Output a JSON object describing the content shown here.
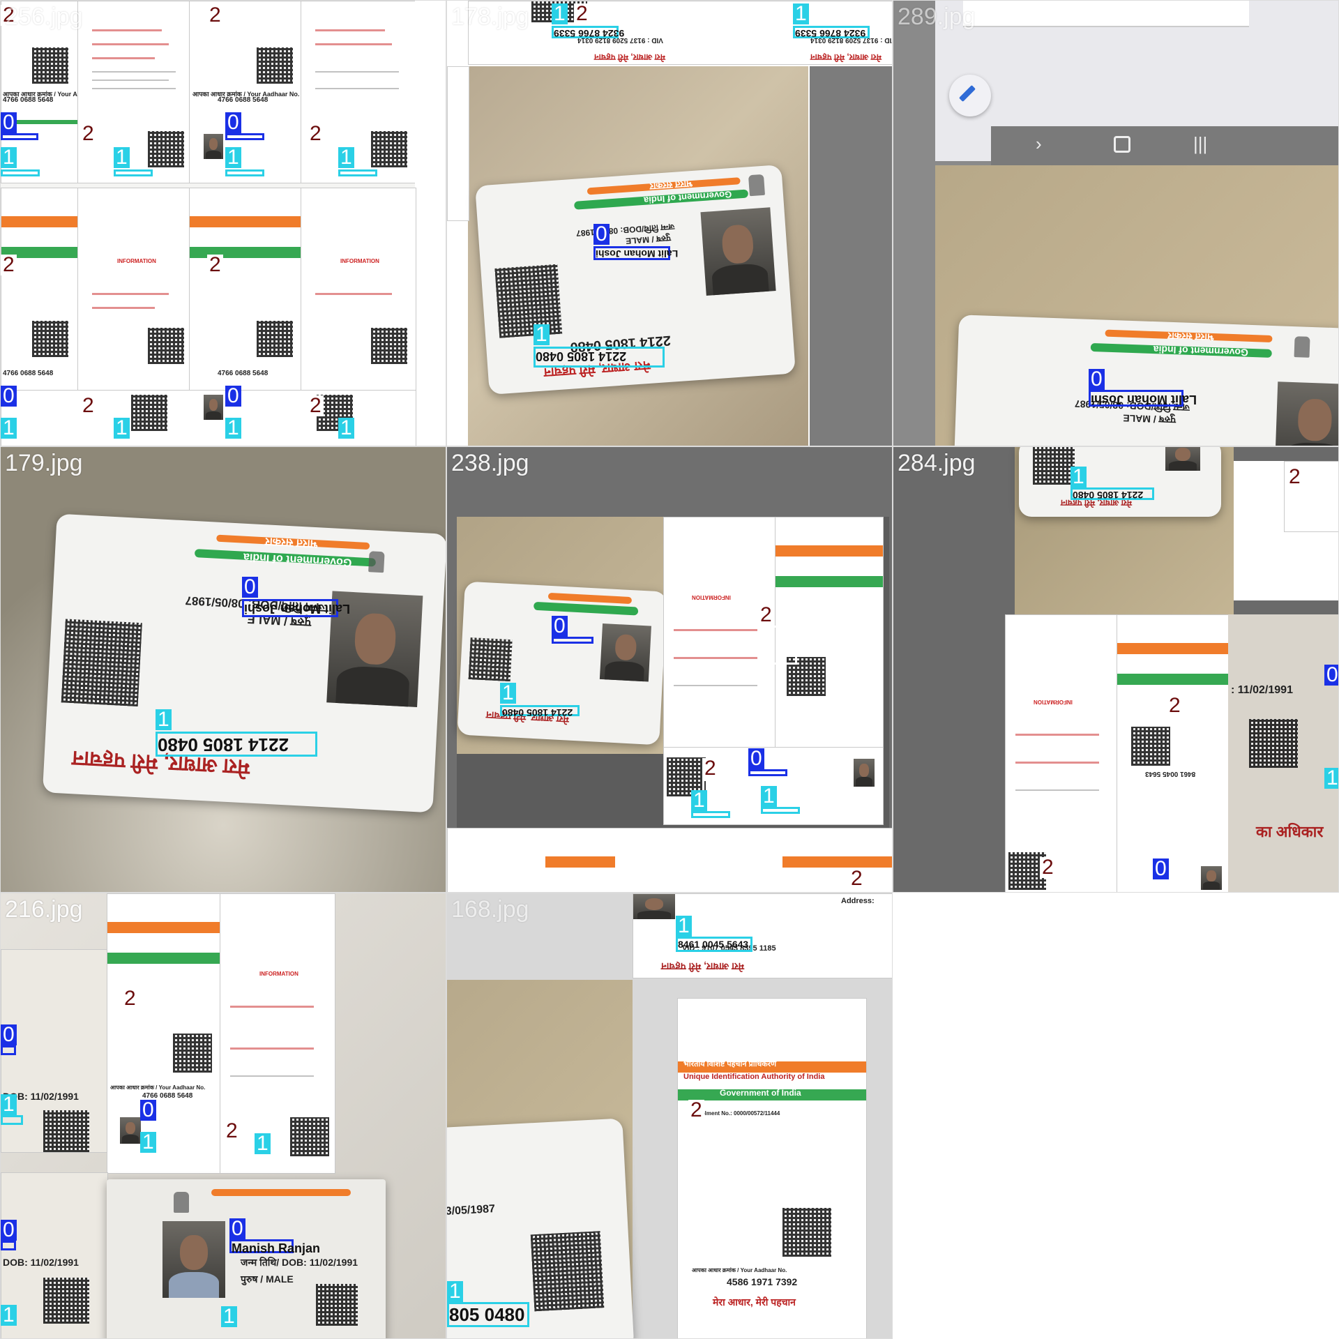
{
  "tiles": [
    {
      "file": "256.jpg"
    },
    {
      "file": "178.jpg"
    },
    {
      "file": "289.jpg"
    },
    {
      "file": "179.jpg"
    },
    {
      "file": "238.jpg"
    },
    {
      "file": "284.jpg"
    },
    {
      "file": "216.jpg"
    },
    {
      "file": "168.jpg"
    }
  ],
  "class_labels": [
    "0",
    "1",
    "2"
  ],
  "class_colors": {
    "0": "#1a30e6",
    "1": "#2ad0e6",
    "2": "#ffffff"
  },
  "card_text": {
    "gov_hi": "भारत सरकार",
    "gov_en": "Government of India",
    "name_lalit": "Lalit Mohan Joshi",
    "dob_lalit": "जन्म तिथि/DOB: 08/05/1987",
    "male": "पुरुष / MALE",
    "num_lalit": "2214 1805 0480",
    "tagline": "मेरा आधार, मेरी पहचान",
    "num_9324": "9324 8766 5339",
    "vid_9324": "VID : 9137 5209 8129 0314",
    "num_4766": "4766 0688 5648",
    "your_aadhaar_no": "आपका आधार क्रमांक / Your Aadhaar No.",
    "num_8461": "8461 0045 5643",
    "vid_8461": "VID : 9107 0543 8395 1185",
    "num_4586": "4586 1971 7392",
    "name_manish": "Manish Ranjan",
    "dob_manish": "जन्म तिथि/ DOB: 11/02/1991",
    "dob_short": "DOB: 11/02/1991",
    "uidai_hi": "भारतीय विशिष्ट पहचान प्राधिकरण",
    "uidai_en": "Unique Identification Authority of India",
    "information": "INFORMATION",
    "enrolment": "/ Enrolment No.: 0000/00572/11444",
    "dob_frag": "3/05/1987",
    "num_frag": "805 0480",
    "address": "Address:",
    "adhikar": "का अधिकार",
    "dob_frag2": ": 11/02/1991"
  }
}
